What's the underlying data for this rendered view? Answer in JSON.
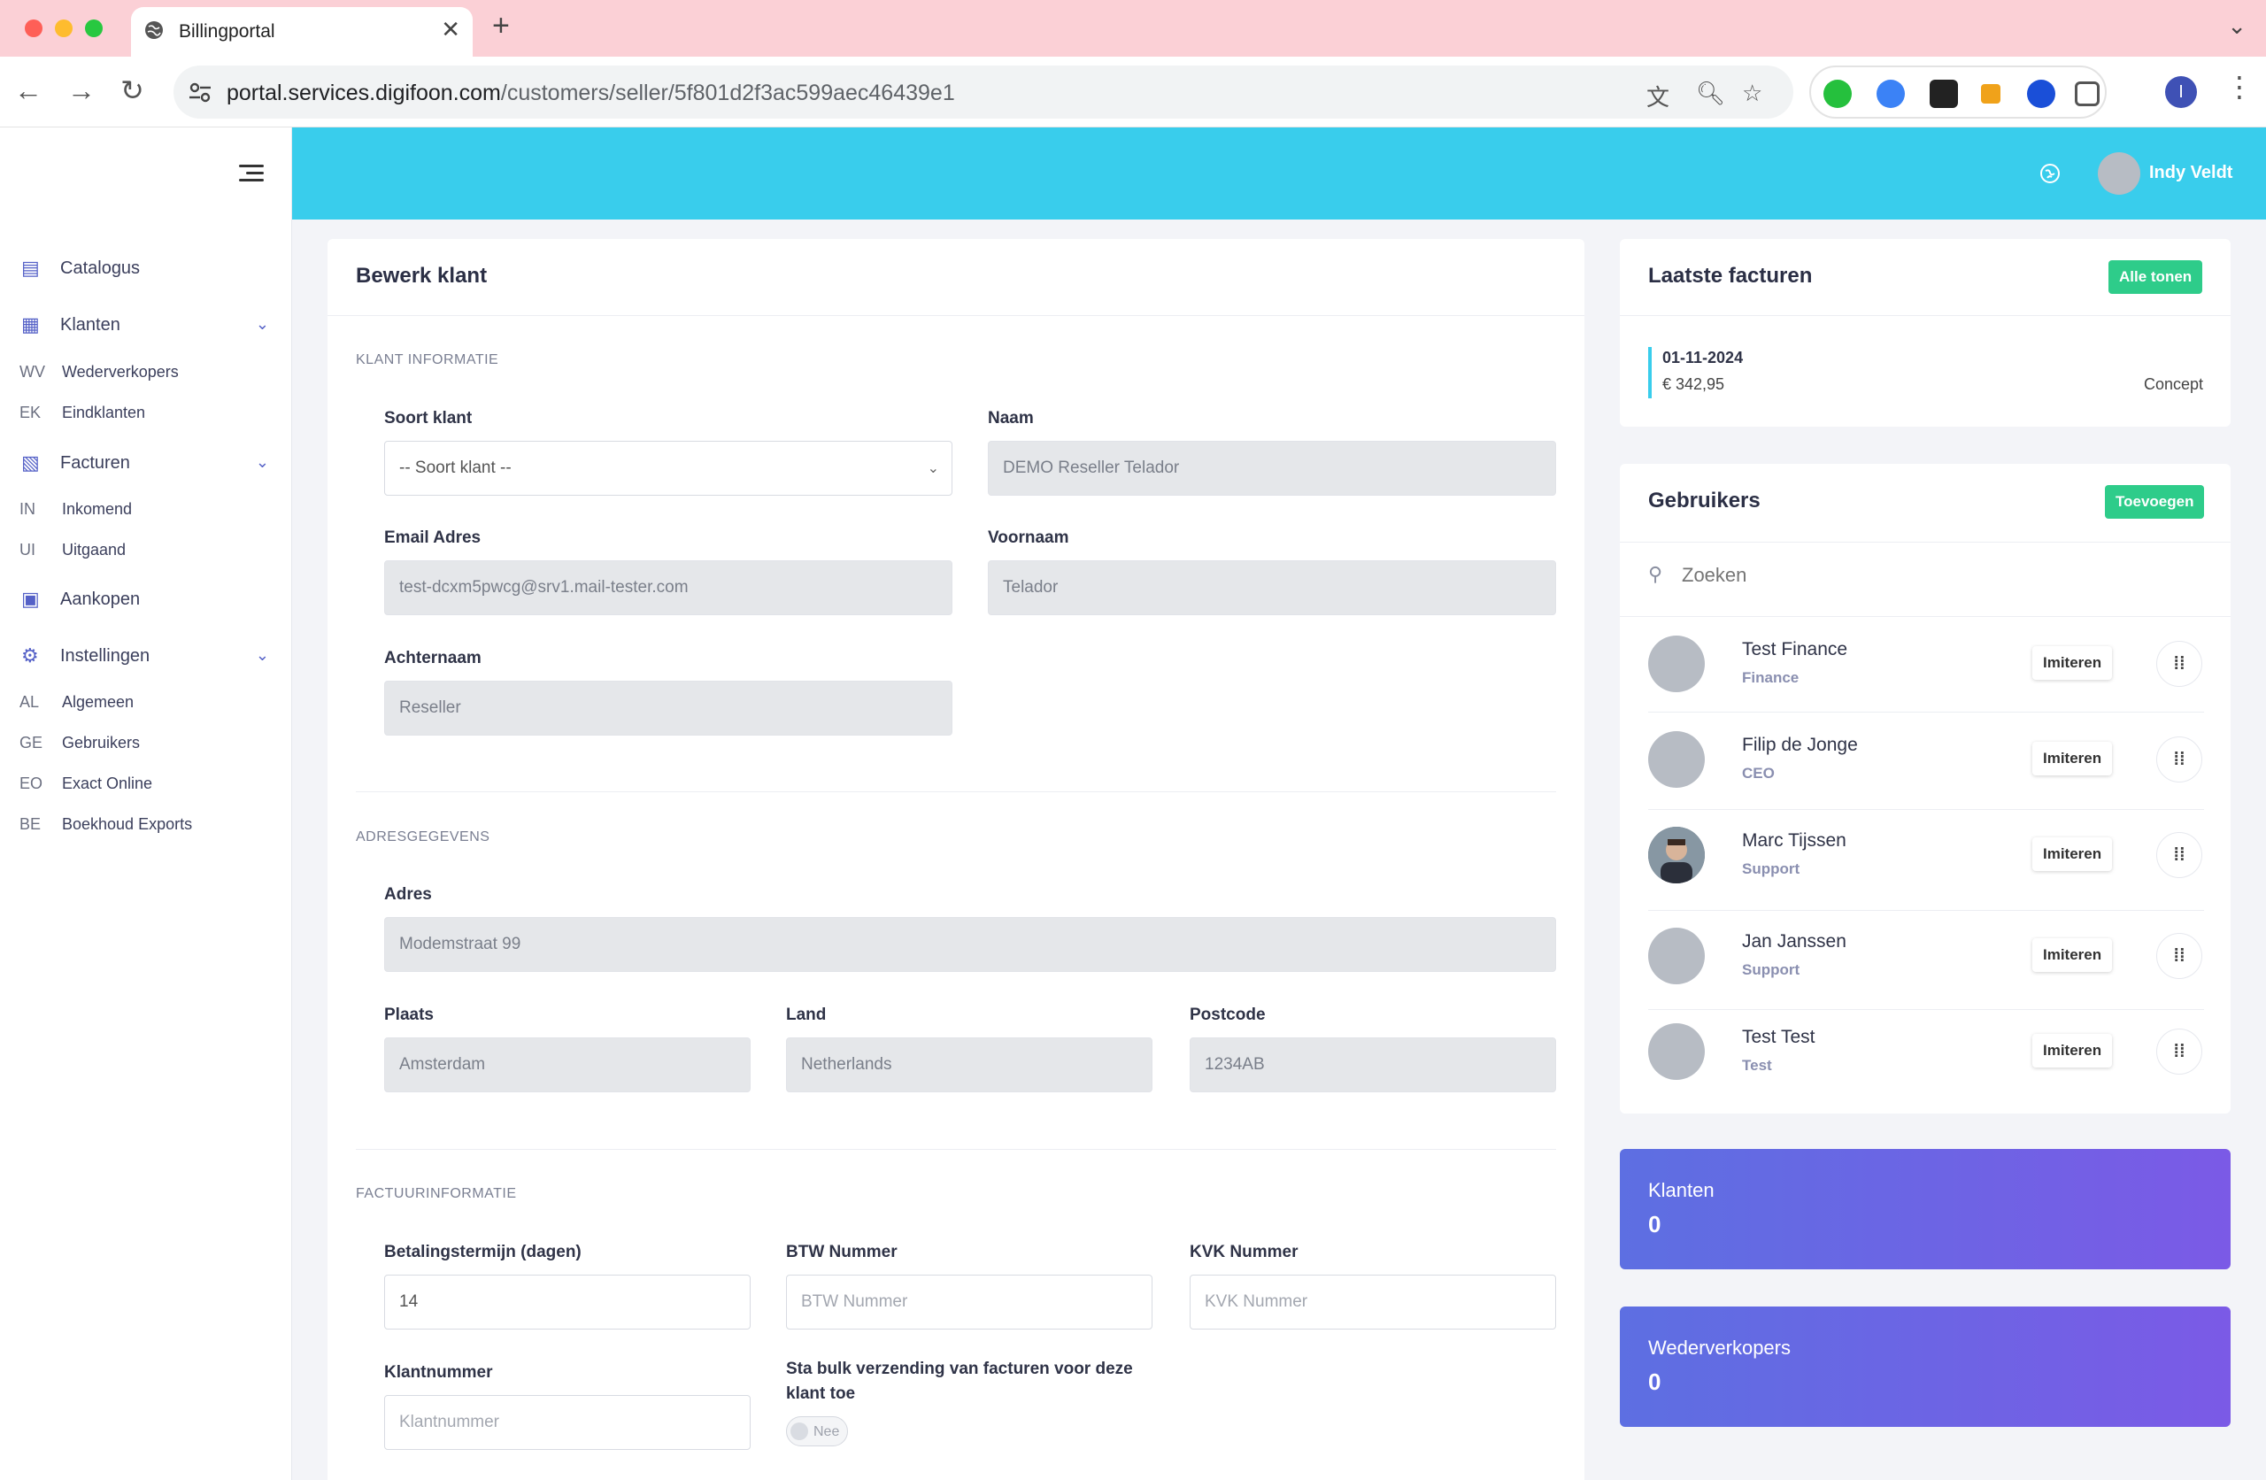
{
  "browser": {
    "tab_title": "Billingportal",
    "url_host": "portal.services.digifoon.com",
    "url_path": "/customers/seller/5f801d2f3ac599aec46439e1",
    "profile_initial": "I"
  },
  "sidebar": {
    "items": [
      {
        "label": "Catalogus"
      },
      {
        "label": "Klanten",
        "children": [
          {
            "abbr": "WV",
            "label": "Wederverkopers"
          },
          {
            "abbr": "EK",
            "label": "Eindklanten"
          }
        ]
      },
      {
        "label": "Facturen",
        "children": [
          {
            "abbr": "IN",
            "label": "Inkomend"
          },
          {
            "abbr": "UI",
            "label": "Uitgaand"
          }
        ]
      },
      {
        "label": "Aankopen"
      },
      {
        "label": "Instellingen",
        "children": [
          {
            "abbr": "AL",
            "label": "Algemeen"
          },
          {
            "abbr": "GE",
            "label": "Gebruikers"
          },
          {
            "abbr": "EO",
            "label": "Exact Online"
          },
          {
            "abbr": "BE",
            "label": "Boekhoud Exports"
          }
        ]
      }
    ]
  },
  "header": {
    "user_name": "Indy Veldt"
  },
  "form": {
    "title": "Bewerk klant",
    "sections": {
      "klant": "KLANT INFORMATIE",
      "adres": "ADRESGEGEVENS",
      "factuur": "FACTUURINFORMATIE"
    },
    "fields": {
      "soort_klant": {
        "label": "Soort klant",
        "value": "-- Soort klant --"
      },
      "naam": {
        "label": "Naam",
        "value": "DEMO Reseller Telador"
      },
      "email": {
        "label": "Email Adres",
        "value": "test-dcxm5pwcg@srv1.mail-tester.com"
      },
      "voornaam": {
        "label": "Voornaam",
        "value": "Telador"
      },
      "achternaam": {
        "label": "Achternaam",
        "value": "Reseller"
      },
      "adres": {
        "label": "Adres",
        "value": "Modemstraat 99"
      },
      "plaats": {
        "label": "Plaats",
        "value": "Amsterdam"
      },
      "land": {
        "label": "Land",
        "value": "Netherlands"
      },
      "postcode": {
        "label": "Postcode",
        "value": "1234AB"
      },
      "betalingstermijn": {
        "label": "Betalingstermijn (dagen)",
        "value": "14"
      },
      "btw": {
        "label": "BTW Nummer",
        "placeholder": "BTW Nummer"
      },
      "kvk": {
        "label": "KVK Nummer",
        "placeholder": "KVK Nummer"
      },
      "klantnummer": {
        "label": "Klantnummer",
        "placeholder": "Klantnummer"
      },
      "bulk": {
        "label_line1": "Sta bulk verzending van facturen voor deze",
        "label_line2": "klant toe",
        "toggle_text": "Nee"
      }
    }
  },
  "invoices": {
    "title": "Laatste facturen",
    "button": "Alle tonen",
    "items": [
      {
        "date": "01-11-2024",
        "amount": "€ 342,95",
        "status": "Concept"
      }
    ]
  },
  "users": {
    "title": "Gebruikers",
    "button": "Toevoegen",
    "search_placeholder": "Zoeken",
    "impersonate_label": "Imiteren",
    "list": [
      {
        "name": "Test Finance",
        "role": "Finance"
      },
      {
        "name": "Filip de Jonge",
        "role": "CEO"
      },
      {
        "name": "Marc Tijssen",
        "role": "Support"
      },
      {
        "name": "Jan Janssen",
        "role": "Support"
      },
      {
        "name": "Test Test",
        "role": "Test"
      }
    ]
  },
  "stats": [
    {
      "label": "Klanten",
      "value": "0"
    },
    {
      "label": "Wederverkopers",
      "value": "0"
    }
  ],
  "colors": {
    "accent": "#39cdec",
    "success": "#2ecc8a",
    "stat_gradient_start": "#5d6fe2",
    "stat_gradient_end": "#7b5ae6"
  }
}
